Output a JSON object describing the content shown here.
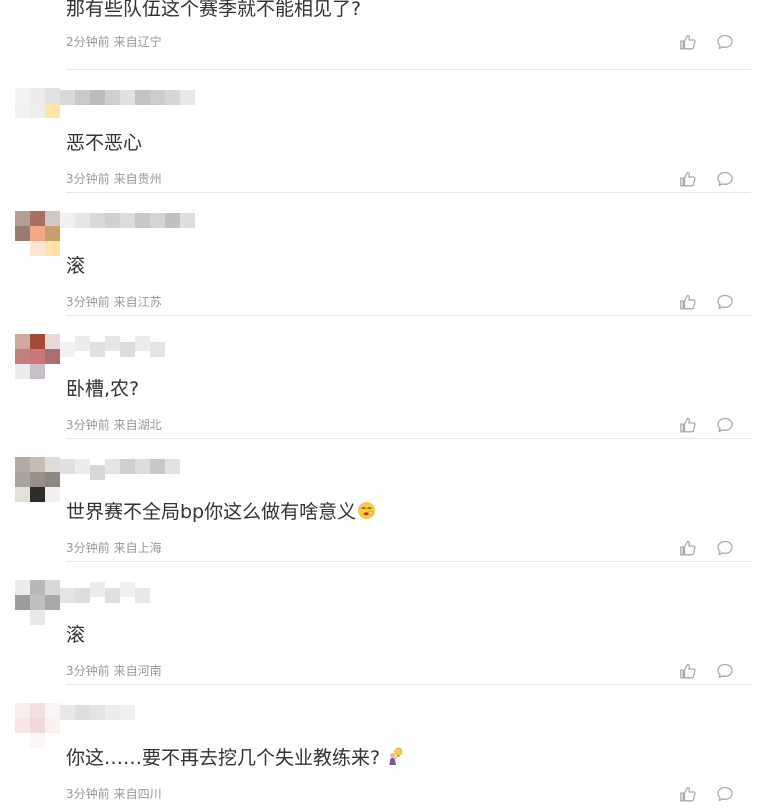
{
  "comments": [
    {
      "text": "那有些队伍这个赛季就不能相见了?",
      "time": "2分钟前",
      "location": "来自辽宁",
      "emoji": null
    },
    {
      "text": "恶不恶心",
      "time": "3分钟前",
      "location": "来自贵州",
      "emoji": null
    },
    {
      "text": "滚",
      "time": "3分钟前",
      "location": "来自江苏",
      "emoji": null
    },
    {
      "text": "卧槽,农?",
      "time": "3分钟前",
      "location": "来自湖北",
      "emoji": null
    },
    {
      "text": "世界赛不全局bp你这么做有啥意义",
      "time": "3分钟前",
      "location": "来自上海",
      "emoji": "shushing-face-emoji"
    },
    {
      "text": "滚",
      "time": "3分钟前",
      "location": "来自河南",
      "emoji": null
    },
    {
      "text": "你这……要不再去挖几个失业教练来?",
      "time": "3分钟前",
      "location": "来自四川",
      "emoji": "person-with-lightbulb-emoji"
    }
  ],
  "icons": {
    "like": "thumbs-up-icon",
    "reply": "comment-bubble-icon"
  },
  "colors": {
    "text": "#333333",
    "meta": "#999999",
    "icon": "#aaaaaa",
    "divider": "#e6e6e6"
  }
}
